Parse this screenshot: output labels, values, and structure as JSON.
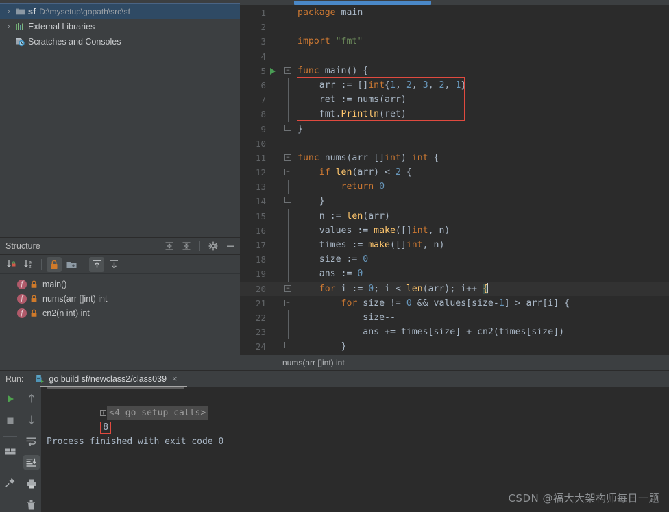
{
  "project_tree": {
    "items": [
      {
        "label": "sf",
        "path": "D:\\mysetup\\gopath\\src\\sf",
        "icon": "folder-icon",
        "chevron": "›",
        "selected": true
      },
      {
        "label": "External Libraries",
        "path": "",
        "icon": "libraries-icon",
        "chevron": "›",
        "selected": false
      },
      {
        "label": "Scratches and Consoles",
        "path": "",
        "icon": "scratches-icon",
        "chevron": "",
        "selected": false
      }
    ]
  },
  "structure": {
    "title": "Structure",
    "header_icons": [
      "expand-all-icon",
      "collapse-all-icon",
      "gear-icon",
      "hide-icon"
    ],
    "toolbar_icons": [
      "sort-by-visibility-icon",
      "sort-alphabetically-icon",
      "show-non-public-icon",
      "show-fields-icon",
      "show-inherited-icon",
      "show-anonymous-icon"
    ],
    "items": [
      {
        "label": "main()",
        "kind": "f",
        "modifier": "lock-icon"
      },
      {
        "label": "nums(arr []int) int",
        "kind": "f",
        "modifier": "lock-icon"
      },
      {
        "label": "cn2(n int) int",
        "kind": "f",
        "modifier": "lock-icon"
      }
    ]
  },
  "editor": {
    "breadcrumb": "nums(arr []int) int",
    "lines": [
      {
        "n": "1",
        "tokens": [
          {
            "t": "package ",
            "c": "kw"
          },
          {
            "t": "main",
            "c": "plain"
          }
        ]
      },
      {
        "n": "2",
        "tokens": []
      },
      {
        "n": "3",
        "tokens": [
          {
            "t": "import ",
            "c": "kw"
          },
          {
            "t": "\"fmt\"",
            "c": "str"
          }
        ]
      },
      {
        "n": "4",
        "tokens": []
      },
      {
        "n": "5",
        "tokens": [
          {
            "t": "func ",
            "c": "kw"
          },
          {
            "t": "main",
            "c": "plain"
          },
          {
            "t": "() {",
            "c": "plain"
          }
        ]
      },
      {
        "n": "6",
        "tokens": [
          {
            "t": "    arr := []",
            "c": "plain"
          },
          {
            "t": "int",
            "c": "kw"
          },
          {
            "t": "{",
            "c": "plain"
          },
          {
            "t": "1",
            "c": "num"
          },
          {
            "t": ", ",
            "c": "plain"
          },
          {
            "t": "2",
            "c": "num"
          },
          {
            "t": ", ",
            "c": "plain"
          },
          {
            "t": "3",
            "c": "num"
          },
          {
            "t": ", ",
            "c": "plain"
          },
          {
            "t": "2",
            "c": "num"
          },
          {
            "t": ", ",
            "c": "plain"
          },
          {
            "t": "1",
            "c": "num"
          },
          {
            "t": "}",
            "c": "plain"
          }
        ]
      },
      {
        "n": "7",
        "tokens": [
          {
            "t": "    ret := ",
            "c": "plain"
          },
          {
            "t": "nums",
            "c": "plain"
          },
          {
            "t": "(arr)",
            "c": "plain"
          }
        ]
      },
      {
        "n": "8",
        "tokens": [
          {
            "t": "    fmt.",
            "c": "plain"
          },
          {
            "t": "Println",
            "c": "fn"
          },
          {
            "t": "(ret)",
            "c": "plain"
          }
        ]
      },
      {
        "n": "9",
        "tokens": [
          {
            "t": "}",
            "c": "plain"
          }
        ]
      },
      {
        "n": "10",
        "tokens": []
      },
      {
        "n": "11",
        "tokens": [
          {
            "t": "func ",
            "c": "kw"
          },
          {
            "t": "nums",
            "c": "plain"
          },
          {
            "t": "(arr []",
            "c": "plain"
          },
          {
            "t": "int",
            "c": "kw"
          },
          {
            "t": ") ",
            "c": "plain"
          },
          {
            "t": "int",
            "c": "kw"
          },
          {
            "t": " {",
            "c": "plain"
          }
        ]
      },
      {
        "n": "12",
        "tokens": [
          {
            "t": "    if ",
            "c": "kw"
          },
          {
            "t": "len",
            "c": "fn"
          },
          {
            "t": "(arr) < ",
            "c": "plain"
          },
          {
            "t": "2",
            "c": "num"
          },
          {
            "t": " {",
            "c": "plain"
          }
        ]
      },
      {
        "n": "13",
        "tokens": [
          {
            "t": "        return ",
            "c": "kw"
          },
          {
            "t": "0",
            "c": "num"
          }
        ]
      },
      {
        "n": "14",
        "tokens": [
          {
            "t": "    }",
            "c": "plain"
          }
        ]
      },
      {
        "n": "15",
        "tokens": [
          {
            "t": "    n := ",
            "c": "plain"
          },
          {
            "t": "len",
            "c": "fn"
          },
          {
            "t": "(arr)",
            "c": "plain"
          }
        ]
      },
      {
        "n": "16",
        "tokens": [
          {
            "t": "    values := ",
            "c": "plain"
          },
          {
            "t": "make",
            "c": "fn"
          },
          {
            "t": "([]",
            "c": "plain"
          },
          {
            "t": "int",
            "c": "kw"
          },
          {
            "t": ", n)",
            "c": "plain"
          }
        ]
      },
      {
        "n": "17",
        "tokens": [
          {
            "t": "    times := ",
            "c": "plain"
          },
          {
            "t": "make",
            "c": "fn"
          },
          {
            "t": "([]",
            "c": "plain"
          },
          {
            "t": "int",
            "c": "kw"
          },
          {
            "t": ", n)",
            "c": "plain"
          }
        ]
      },
      {
        "n": "18",
        "tokens": [
          {
            "t": "    size := ",
            "c": "plain"
          },
          {
            "t": "0",
            "c": "num"
          }
        ]
      },
      {
        "n": "19",
        "tokens": [
          {
            "t": "    ans := ",
            "c": "plain"
          },
          {
            "t": "0",
            "c": "num"
          }
        ]
      },
      {
        "n": "20",
        "tokens": [
          {
            "t": "    for ",
            "c": "kw"
          },
          {
            "t": "i := ",
            "c": "plain"
          },
          {
            "t": "0",
            "c": "num"
          },
          {
            "t": "; i < ",
            "c": "plain"
          },
          {
            "t": "len",
            "c": "fn"
          },
          {
            "t": "(arr); i++ ",
            "c": "plain"
          },
          {
            "t": "{",
            "c": "brace"
          }
        ]
      },
      {
        "n": "21",
        "tokens": [
          {
            "t": "        for ",
            "c": "kw"
          },
          {
            "t": "size != ",
            "c": "plain"
          },
          {
            "t": "0",
            "c": "num"
          },
          {
            "t": " && values[size-",
            "c": "plain"
          },
          {
            "t": "1",
            "c": "num"
          },
          {
            "t": "] > arr[i] {",
            "c": "plain"
          }
        ]
      },
      {
        "n": "22",
        "tokens": [
          {
            "t": "            size--",
            "c": "plain"
          }
        ]
      },
      {
        "n": "23",
        "tokens": [
          {
            "t": "            ans += times[size] + ",
            "c": "plain"
          },
          {
            "t": "cn2",
            "c": "plain"
          },
          {
            "t": "(times[size])",
            "c": "plain"
          }
        ]
      },
      {
        "n": "24",
        "tokens": [
          {
            "t": "        }",
            "c": "plain"
          }
        ]
      }
    ]
  },
  "run_panel": {
    "run_label": "Run:",
    "tab_label": "go build sf/newclass2/class039",
    "tab_close": "×",
    "tab_icon": "go-run-config-icon",
    "left_toolbar": [
      "rerun-icon",
      "stop-icon",
      "layout-icon",
      "pin-icon"
    ],
    "right_toolbar": [
      "scroll-up-icon",
      "scroll-down-icon",
      "soft-wrap-icon",
      "scroll-to-end-icon",
      "print-icon",
      "clear-all-icon"
    ],
    "console": {
      "setup_line": "<4 go setup calls>",
      "expander": "+",
      "output_value": "8",
      "exit_line": "Process finished with exit code 0"
    }
  },
  "watermark": "CSDN @福大大架构师每日一题",
  "colors": {
    "editor_bg": "#2b2b2b",
    "panel_bg": "#3c3f41",
    "selection_blue": "#2f4a64",
    "keyword": "#cc7832",
    "string": "#6a8759",
    "number": "#6897bb",
    "function": "#ffc66d",
    "highlight_red": "#e04a3f",
    "run_green": "#499c54",
    "scrollbar_blue": "#4a88c7"
  }
}
